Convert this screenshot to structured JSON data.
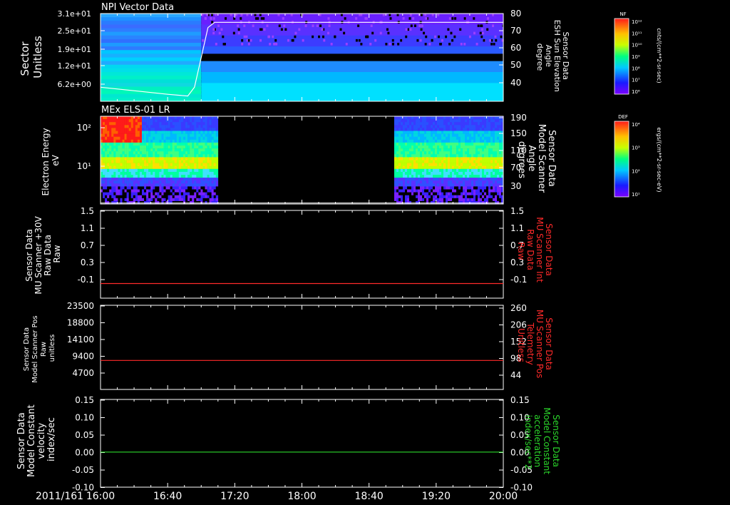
{
  "colors": {
    "background": "#000000",
    "axis": "#ffffff",
    "red_trace": "#ff2a2a",
    "green_trace": "#2bd82b",
    "white_trace": "#ffffff"
  },
  "chart_data": [
    {
      "type": "heatmap",
      "title": "NPI Vector Data",
      "ylabel_left": [
        "Sector",
        "Unitless"
      ],
      "ylabel_right": [
        "Sensor Data",
        "ESH Sun Elevation",
        "Angle",
        "degree"
      ],
      "left_ticks": [
        "3.1e+01",
        "2.5e+01",
        "1.9e+01",
        "1.2e+01",
        "6.2e+00"
      ],
      "right_ticks": [
        "80",
        "70",
        "60",
        "50",
        "40"
      ],
      "right_ylim": [
        30,
        80
      ],
      "colorbar": {
        "label": "NF",
        "units": "cnts/(cm**2-sr-sec)",
        "ticks": [
          "10¹²",
          "10¹¹",
          "10¹⁰",
          "10⁹",
          "10⁸",
          "10⁷",
          "10⁶"
        ]
      },
      "overlay_line": {
        "name": "ESH Sun Elevation Angle",
        "x": [
          "16:00",
          "16:20",
          "16:40",
          "16:52",
          "16:56",
          "17:00",
          "17:04",
          "17:08",
          "18:00",
          "20:00"
        ],
        "y": [
          38,
          36,
          34,
          33,
          38,
          55,
          72,
          75,
          75,
          75
        ]
      }
    },
    {
      "type": "heatmap",
      "title": "MEx ELS-01 LR",
      "ylabel_left": [
        "Electron Energy",
        "eV"
      ],
      "ylabel_right": [
        "Sensor Data",
        "Model Scanner",
        "Angle",
        "degrees"
      ],
      "left_ticks": [
        "10²",
        "10¹"
      ],
      "right_ticks": [
        "190",
        "150",
        "110",
        "70",
        "30"
      ],
      "right_ylim": [
        10,
        190
      ],
      "data_gap": [
        "17:10",
        "18:55"
      ],
      "colorbar": {
        "label": "DEF",
        "units": "ergs/(cm**2-sr-sec-eV)",
        "ticks": [
          "10⁴",
          "10³",
          "10²",
          "10¹"
        ]
      },
      "overlay_line": {
        "name": "Model Scanner Angle",
        "x": [
          "16:00",
          "20:00"
        ],
        "y": [
          12,
          12
        ]
      }
    },
    {
      "type": "line",
      "ylabel_left": [
        "Sensor Data",
        "MU Scanner +30V",
        "Raw Data",
        "Raw"
      ],
      "ylabel_right": [
        "Sensor Data",
        "MU Scanner Int",
        "Raw Data",
        "Raw"
      ],
      "left_ticks": [
        "1.5",
        "1.1",
        "0.7",
        "0.3",
        "-0.1"
      ],
      "right_ticks": [
        "1.5",
        "1.1",
        "0.7",
        "0.3",
        "-0.1"
      ],
      "ylim": [
        -0.3,
        1.5
      ],
      "series": [
        {
          "x": [
            "16:00",
            "20:00"
          ],
          "y": [
            0.0,
            0.0
          ],
          "color": "#ff2a2a"
        }
      ]
    },
    {
      "type": "line",
      "ylabel_left": [
        "Sensor Data",
        "Model Scanner Pos",
        "Raw",
        "unitless"
      ],
      "ylabel_right": [
        "Sensor Data",
        "MU Scanner Pos",
        "Telemetry",
        "Unitless"
      ],
      "left_ticks": [
        "23500",
        "18800",
        "14100",
        "9400",
        "4700"
      ],
      "right_ticks": [
        "260",
        "206",
        "152",
        "98",
        "44"
      ],
      "ylim": [
        0,
        23500
      ],
      "series": [
        {
          "x": [
            "16:00",
            "20:00"
          ],
          "y": [
            8100,
            8100
          ],
          "color": "#ff2a2a"
        }
      ]
    },
    {
      "type": "line",
      "ylabel_left": [
        "Sensor Data",
        "Model Constant",
        "velocity",
        "index/sec"
      ],
      "ylabel_right": [
        "Sensor Data",
        "Model Constant",
        "acceleration",
        "index/sec**2"
      ],
      "left_ticks": [
        "0.15",
        "0.10",
        "0.05",
        "0.00",
        "-0.05",
        "-0.10"
      ],
      "right_ticks": [
        "0.15",
        "0.10",
        "0.05",
        "0.00",
        "-0.05",
        "-0.10"
      ],
      "ylim": [
        -0.1,
        0.15
      ],
      "series": [
        {
          "x": [
            "16:00",
            "20:00"
          ],
          "y": [
            0.0,
            0.0
          ],
          "color": "#2bd82b"
        }
      ]
    }
  ],
  "x_axis": {
    "date_label": "2011/161",
    "ticks": [
      "16:00",
      "16:40",
      "17:20",
      "18:00",
      "18:40",
      "19:20",
      "20:00"
    ]
  }
}
